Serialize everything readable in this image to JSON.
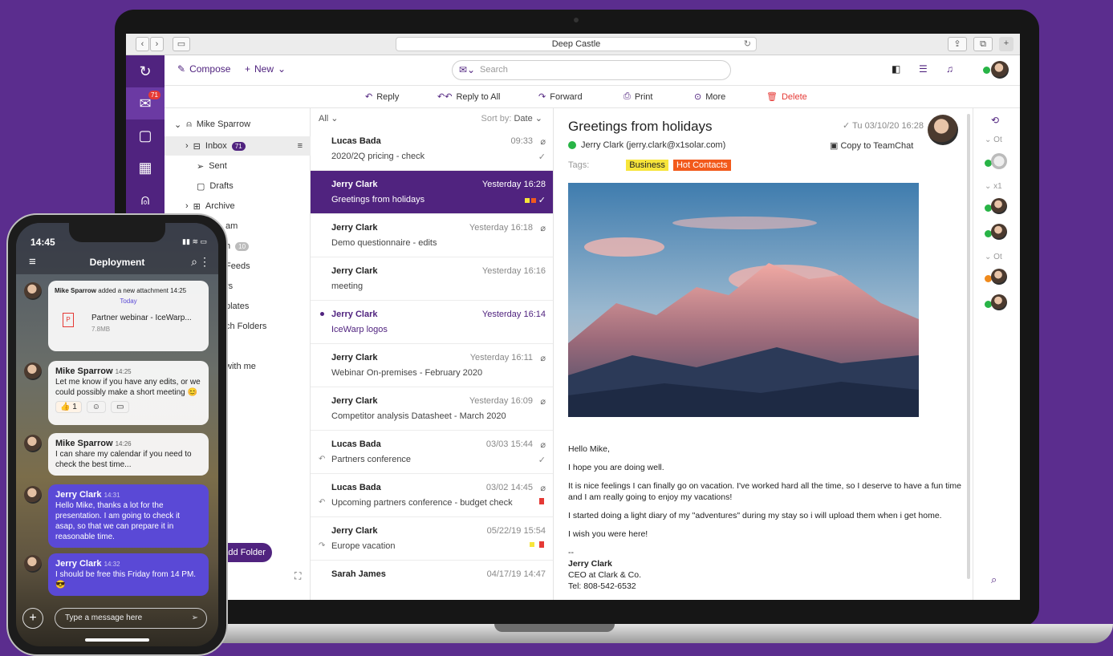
{
  "browser": {
    "url": "Deep Castle"
  },
  "rail": {
    "mail_badge": "71"
  },
  "toolbar": {
    "compose": "Compose",
    "new": "New",
    "search_placeholder": "Search"
  },
  "actions": {
    "reply": "Reply",
    "reply_all": "Reply to All",
    "forward": "Forward",
    "print": "Print",
    "more": "More",
    "delete": "Delete"
  },
  "folders": {
    "account": "Mike Sparrow",
    "items": [
      {
        "label": "Inbox",
        "count": "71"
      },
      {
        "label": "Sent"
      },
      {
        "label": "Drafts"
      },
      {
        "label": "Archive"
      },
      {
        "label": "am"
      },
      {
        "label": "h",
        "count": "10"
      },
      {
        "label": "Feeds"
      },
      {
        "label": "rs"
      },
      {
        "label": "plates"
      },
      {
        "label": "ch Folders"
      },
      {
        "label": "with me"
      }
    ],
    "add_folder": "Add Folder"
  },
  "list": {
    "filter": "All",
    "sort_label": "Sort by:",
    "sort_value": "Date",
    "messages": [
      {
        "from": "Lucas Bada",
        "subject": "2020/2Q pricing - check",
        "date": "09:33"
      },
      {
        "from": "Jerry Clark",
        "subject": "Greetings from holidays",
        "date": "Yesterday 16:28"
      },
      {
        "from": "Jerry Clark",
        "subject": "Demo questionnaire - edits",
        "date": "Yesterday 16:18"
      },
      {
        "from": "Jerry Clark",
        "subject": "meeting",
        "date": "Yesterday 16:16"
      },
      {
        "from": "Jerry Clark",
        "subject": "IceWarp logos",
        "date": "Yesterday 16:14"
      },
      {
        "from": "Jerry Clark",
        "subject": "Webinar On-premises - February 2020",
        "date": "Yesterday 16:11"
      },
      {
        "from": "Jerry Clark",
        "subject": "Competitor analysis Datasheet - March 2020",
        "date": "Yesterday 16:09"
      },
      {
        "from": "Lucas Bada",
        "subject": "Partners conference",
        "date": "03/03 15:44"
      },
      {
        "from": "Lucas Bada",
        "subject": "Upcoming partners conference - budget check",
        "date": "03/02 14:45"
      },
      {
        "from": "Jerry Clark",
        "subject": "Europe vacation",
        "date": "05/22/19 15:54"
      },
      {
        "from": "Sarah James",
        "subject": "",
        "date": "04/17/19 14:47"
      }
    ]
  },
  "reader": {
    "subject": "Greetings from holidays",
    "date": "Tu 03/10/20 16:28",
    "from": "Jerry Clark (jerry.clark@x1solar.com)",
    "copy_to_teamchat": "Copy to TeamChat",
    "tags_label": "Tags:",
    "tags": [
      {
        "label": "Business",
        "color": "#f7e53b"
      },
      {
        "label": "Hot Contacts",
        "color": "#f25a1c"
      }
    ],
    "body": [
      "Hello Mike,",
      "I hope you are doing well.",
      "It is nice feelings I can finally go on vacation. I've worked hard all the time, so I deserve to have a fun time and I am really going to enjoy my vacations!",
      "I started doing a light diary of my \"adventures\" during my stay so i will upload them when i get home.",
      "I wish you were here!"
    ],
    "signature_dash": "--",
    "signature_name": "Jerry Clark",
    "signature_company": "CEO at Clark & Co.",
    "signature_tel": "Tel: 808-542-6532"
  },
  "contacts": {
    "groups": [
      "Ot",
      "x1",
      "Ot"
    ]
  },
  "phone": {
    "time": "14:45",
    "title": "Deployment",
    "attach_note_name": "Mike Sparrow",
    "attach_note_text": "added a new attachment",
    "attach_note_time": "14:25",
    "attach_note_day": "Today",
    "file_name": "Partner webinar - IceWarp...",
    "file_size": "7.8MB",
    "messages": [
      {
        "name": "Mike Sparrow",
        "time": "14:25",
        "text": "Let me know if you have any edits, or we could possibly make a short meeting 😊"
      },
      {
        "name": "Mike Sparrow",
        "time": "14:26",
        "text": "I can share my calendar if you need to check the best time..."
      },
      {
        "name": "Jerry Clark",
        "time": "14:31",
        "text": "Hello Mike, thanks a lot for the presentation. I am going to check it asap, so that we can prepare it in reasonable time."
      },
      {
        "name": "Jerry Clark",
        "time": "14:32",
        "text": "I should be free this Friday from 14 PM. 😎"
      }
    ],
    "reaction_count": "1",
    "input_placeholder": "Type a message here"
  },
  "colors": {
    "brand": "#50237f",
    "background": "#5b2d8e",
    "bubble": "#5a49d6",
    "danger": "#e53935"
  }
}
